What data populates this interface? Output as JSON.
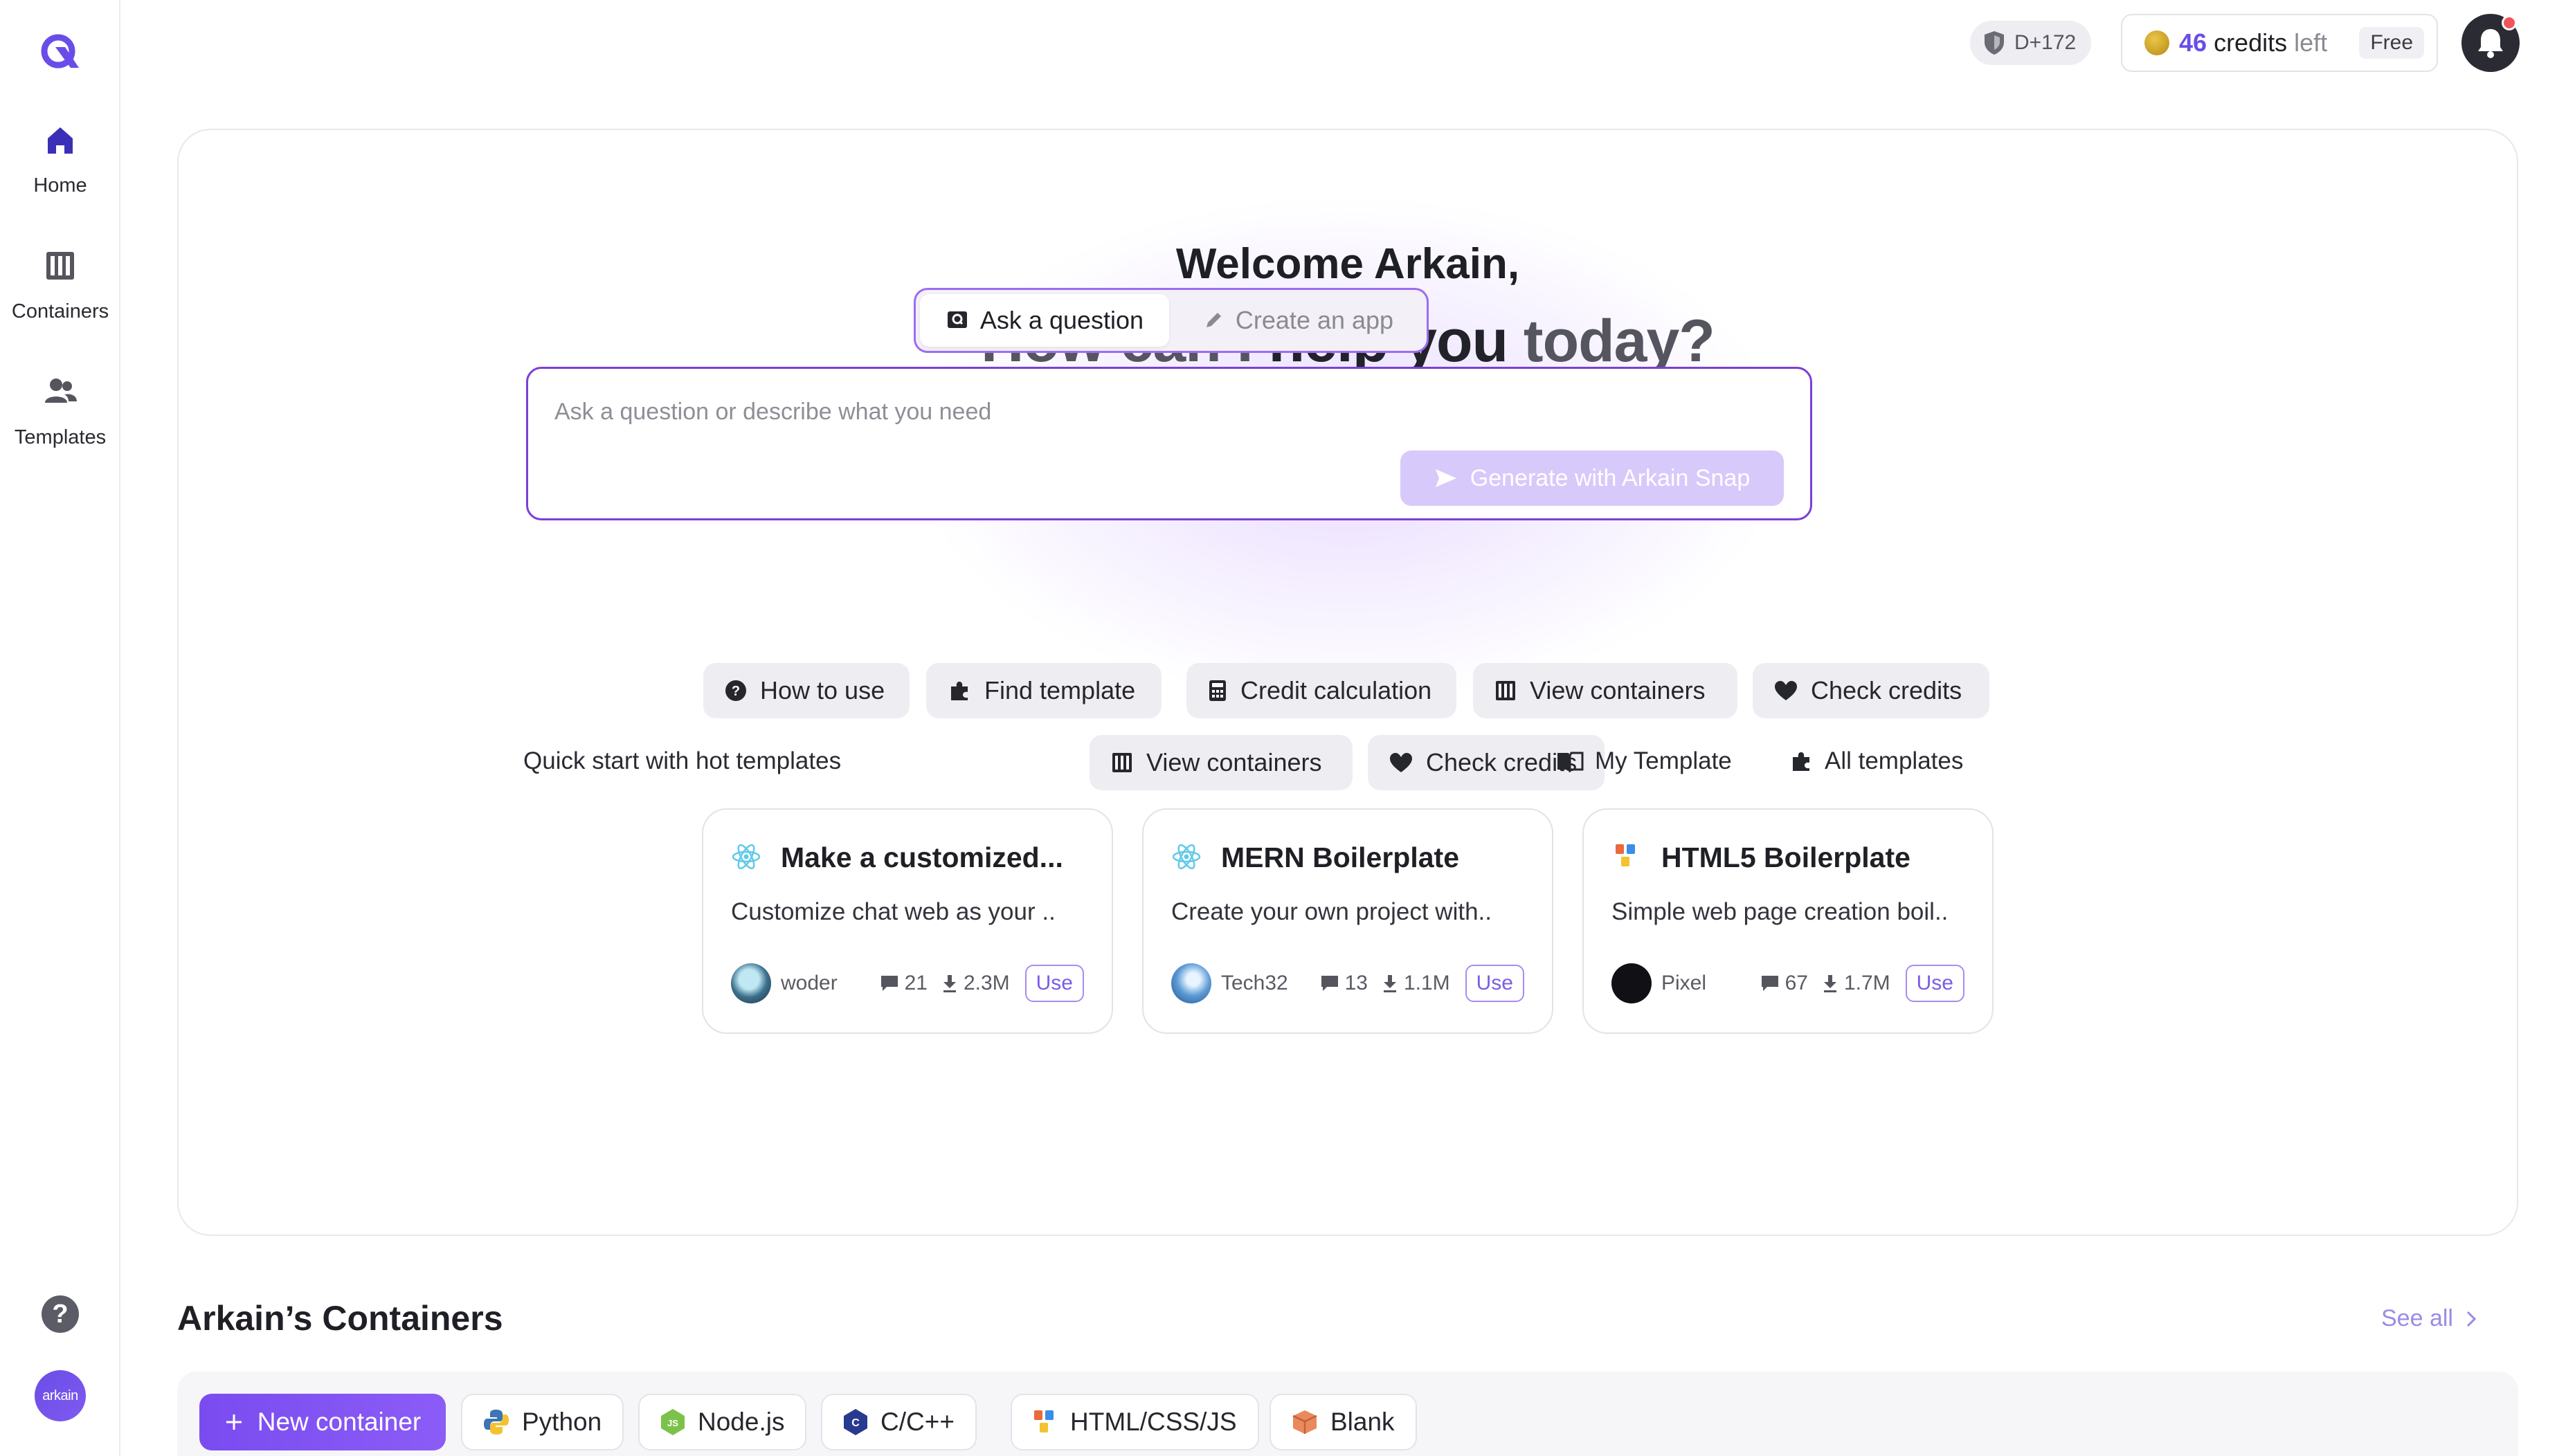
{
  "sidebar": {
    "items": [
      {
        "label": "Home"
      },
      {
        "label": "Containers"
      },
      {
        "label": "Templates"
      }
    ],
    "help_symbol": "?",
    "avatar_text": "arkain"
  },
  "topbar": {
    "badge": "D+172",
    "credits_value": "46",
    "credits_word": "credits",
    "credits_left": "left",
    "plan": "Free"
  },
  "hero": {
    "welcome": "Welcome Arkain,",
    "headline_part1": "How can I ",
    "headline_part2": "help you",
    "headline_part3": " today?",
    "modes": [
      {
        "label": "Ask a question",
        "active": true
      },
      {
        "label": "Create an app",
        "active": false
      }
    ],
    "ask_placeholder": "Ask a question or describe what you need",
    "generate_label": "Generate with Arkain Snap",
    "chips_row1": [
      "How to use",
      "Find template",
      "Credit calculation",
      "View containers",
      "Check credits"
    ],
    "chips_row2": [
      "View containers",
      "Check credits"
    ],
    "quick_start_title": "Quick start with hot templates",
    "my_template": "My Template",
    "all_templates": "All templates",
    "templates": [
      {
        "title": "Make a customized...",
        "desc": "Customize chat web as your ..",
        "author": "woder",
        "comments": "21",
        "downloads": "2.3M",
        "use": "Use",
        "icon": "react-icon"
      },
      {
        "title": "MERN Boilerplate",
        "desc": "Create your own project with..",
        "author": "Tech32",
        "comments": "13",
        "downloads": "1.1M",
        "use": "Use",
        "icon": "react-icon"
      },
      {
        "title": "HTML5 Boilerplate",
        "desc": "Simple web page creation boil..",
        "author": "Pixel",
        "comments": "67",
        "downloads": "1.7M",
        "use": "Use",
        "icon": "html-css-js-icon"
      }
    ]
  },
  "containers": {
    "title": "Arkain’s Containers",
    "see_all": "See all",
    "new_container": "New container",
    "languages": [
      "Python",
      "Node.js",
      "C/C++",
      "HTML/CSS/JS",
      "Blank"
    ]
  },
  "colors": {
    "accent": "#7c3fd6",
    "accent_light": "#d8c9fb",
    "credits_purple": "#6a4de8",
    "notification_red": "#f2545b"
  }
}
